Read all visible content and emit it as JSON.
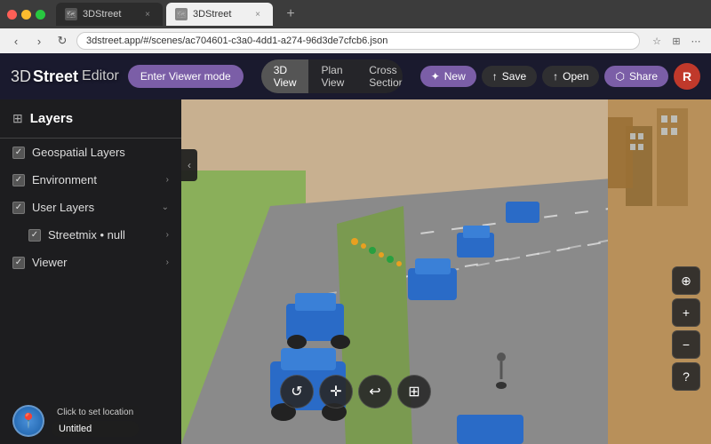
{
  "browser": {
    "tabs": [
      {
        "id": "tab1",
        "label": "3DStreet",
        "active": false,
        "favicon": "🗺"
      },
      {
        "id": "tab2",
        "label": "3DStreet",
        "active": true,
        "favicon": "🗺"
      }
    ],
    "address": "3dstreet.app/#/scenes/ac704601-c3a0-4dd1-a274-96d3de7cfcb6.json",
    "add_tab_label": "+"
  },
  "header": {
    "logo_3d": "3D",
    "logo_street": "Street",
    "logo_editor": "Editor",
    "viewer_mode_btn": "Enter Viewer mode",
    "view_tabs": [
      {
        "id": "3d",
        "label": "3D View",
        "active": true
      },
      {
        "id": "plan",
        "label": "Plan View",
        "active": false
      },
      {
        "id": "cross",
        "label": "Cross Section",
        "active": false
      }
    ],
    "actions": [
      {
        "id": "new",
        "label": "New",
        "icon": "✦"
      },
      {
        "id": "save",
        "label": "Save",
        "icon": "↑"
      },
      {
        "id": "open",
        "label": "Open",
        "icon": "↑"
      },
      {
        "id": "share",
        "label": "Share",
        "icon": "⬡"
      }
    ],
    "user_avatar_initial": "R"
  },
  "layers_panel": {
    "title": "Layers",
    "items": [
      {
        "id": "geospatial",
        "label": "Geospatial Layers",
        "checked": true,
        "has_arrow": false,
        "indent": 0
      },
      {
        "id": "environment",
        "label": "Environment",
        "checked": true,
        "has_arrow": true,
        "indent": 0
      },
      {
        "id": "user-layers",
        "label": "User Layers",
        "checked": true,
        "has_arrow": true,
        "indent": 0
      },
      {
        "id": "streetmix",
        "label": "Streetmix • null",
        "checked": true,
        "has_arrow": true,
        "indent": 1
      },
      {
        "id": "viewer",
        "label": "Viewer",
        "checked": true,
        "has_arrow": true,
        "indent": 0
      }
    ]
  },
  "toolbar": {
    "tools": [
      {
        "id": "rotate",
        "icon": "↺",
        "label": "Rotate"
      },
      {
        "id": "move",
        "icon": "✛",
        "label": "Move"
      },
      {
        "id": "curve",
        "icon": "↩",
        "label": "Curve"
      },
      {
        "id": "scale",
        "icon": "⊞",
        "label": "Scale"
      }
    ]
  },
  "map_controls": [
    {
      "id": "compass",
      "icon": "⊕",
      "label": "Compass"
    },
    {
      "id": "zoom-in",
      "icon": "+",
      "label": "Zoom In"
    },
    {
      "id": "zoom-out",
      "icon": "−",
      "label": "Zoom Out"
    },
    {
      "id": "help",
      "icon": "?",
      "label": "Help"
    }
  ],
  "location": {
    "click_text": "Click to set location",
    "name": "Untitled"
  },
  "colors": {
    "purple": "#7b5ea7",
    "dark_panel": "rgba(30,30,30,0.93)",
    "car_blue": "#3a7bd5"
  }
}
